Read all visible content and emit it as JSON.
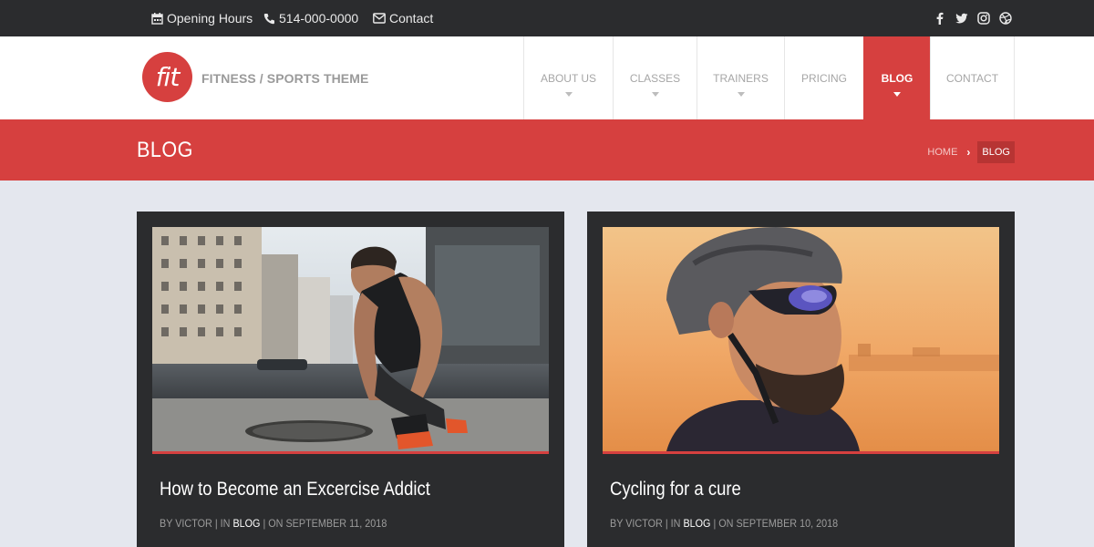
{
  "topbar": {
    "hours": "Opening Hours",
    "phone": "514-000-0000",
    "contact": "Contact",
    "social": [
      "facebook-icon",
      "twitter-icon",
      "instagram-icon",
      "dribbble-icon"
    ]
  },
  "header": {
    "logo_text": "fit",
    "tagline": "FITNESS / SPORTS THEME",
    "nav": [
      {
        "label": "ABOUT US",
        "dropdown": true
      },
      {
        "label": "CLASSES",
        "dropdown": true
      },
      {
        "label": "TRAINERS",
        "dropdown": true
      },
      {
        "label": "PRICING",
        "dropdown": false
      },
      {
        "label": "BLOG",
        "dropdown": true,
        "active": true
      },
      {
        "label": "CONTACT",
        "dropdown": false
      }
    ]
  },
  "banner": {
    "title": "BLOG",
    "breadcrumb_home": "HOME",
    "breadcrumb_sep": "›",
    "breadcrumb_current": "BLOG"
  },
  "posts": [
    {
      "title": "How to Become an Excercise Addict",
      "by": "BY VICTOR | IN ",
      "category": "BLOG",
      "date": " | ON SEPTEMBER 11, 2018"
    },
    {
      "title": "Cycling for a cure",
      "by": "BY VICTOR | IN ",
      "category": "BLOG",
      "date": " | ON SEPTEMBER 10, 2018"
    }
  ],
  "colors": {
    "accent": "#d6403f",
    "dark": "#2b2c2e",
    "page_bg": "#e4e7ee"
  }
}
